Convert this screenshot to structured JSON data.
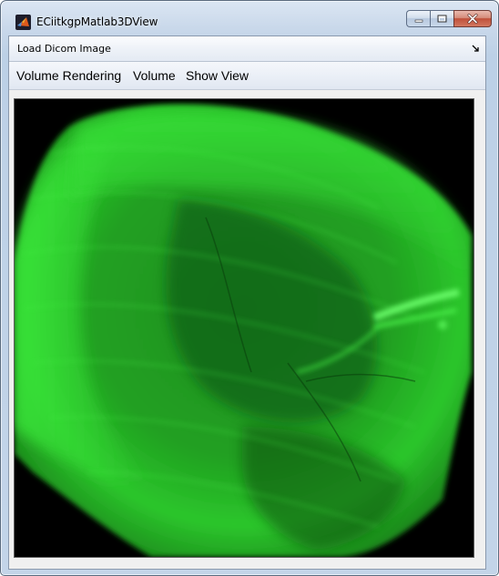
{
  "window": {
    "title": "ECiitkgpMatlab3DView",
    "icon": "matlab-icon"
  },
  "caption_buttons": {
    "minimize": "minimize-icon",
    "maximize": "maximize-icon",
    "close": "close-icon"
  },
  "toolbar": {
    "load_label": "Load Dicom Image",
    "dock_icon": "undock-arrow-icon"
  },
  "menu": {
    "items": [
      {
        "label": "Volume Rendering"
      },
      {
        "label": "Volume"
      },
      {
        "label": "Show View"
      }
    ]
  },
  "viewport": {
    "content": "volume-rendering-image",
    "background_color": "#000000",
    "render_color": "#27d827"
  }
}
